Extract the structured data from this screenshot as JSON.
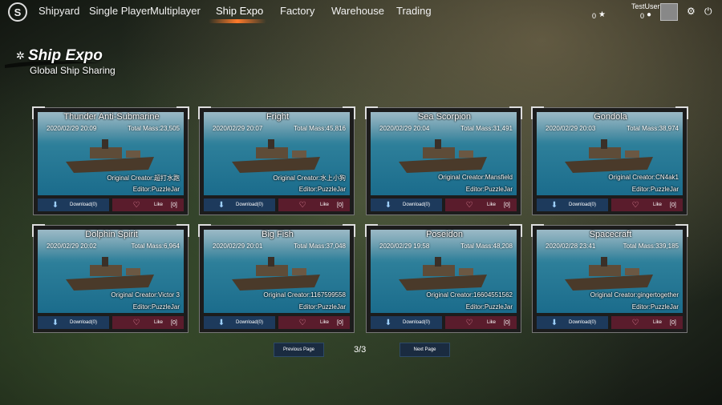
{
  "nav": {
    "logo_letter": "S",
    "items": [
      "Shipyard",
      "Single Player",
      "Multiplayer",
      "Ship Expo",
      "Factory",
      "Warehouse",
      "Trading"
    ],
    "active": "Ship Expo"
  },
  "user": {
    "name": "TestUser",
    "stars": "0",
    "coins": "0"
  },
  "icons": {
    "logo": "ship-wheel-logo",
    "star": "star-icon",
    "coin": "coin-icon",
    "settings": "gear-icon",
    "power": "power-icon"
  },
  "header": {
    "title": "Ship Expo",
    "subtitle": "Global Ship Sharing"
  },
  "cards": [
    {
      "name": "Thunder Anti-Submarine",
      "date": "2020/02/29 20:09",
      "mass": "Total Mass:23,505",
      "creator": "Original Creator:超打水跑",
      "editor": "Editor:PuzzleJar",
      "download": "Download(0)",
      "like": "Like",
      "likes": "[0]"
    },
    {
      "name": "Fright",
      "date": "2020/02/29 20:07",
      "mass": "Total Mass:45,816",
      "creator": "Original Creator:水上小狗",
      "editor": "Editor:PuzzleJar",
      "download": "Download(0)",
      "like": "Like",
      "likes": "[0]"
    },
    {
      "name": "Sea Scorpion",
      "date": "2020/02/29 20:04",
      "mass": "Total Mass:31,491",
      "creator": "Original Creator:Mansfield",
      "editor": "Editor:PuzzleJar",
      "download": "Download(0)",
      "like": "Like",
      "likes": "[0]"
    },
    {
      "name": "Gondola",
      "date": "2020/02/29 20:03",
      "mass": "Total Mass:38,974",
      "creator": "Original Creator:CN4ak1",
      "editor": "Editor:PuzzleJar",
      "download": "Download(0)",
      "like": "Like",
      "likes": "[0]"
    },
    {
      "name": "Dolphin Spirit",
      "date": "2020/02/29 20:02",
      "mass": "Total Mass:6,964",
      "creator": "Original Creator:Victor 3",
      "editor": "Editor:PuzzleJar",
      "download": "Download(0)",
      "like": "Like",
      "likes": "[0]"
    },
    {
      "name": "Big Fish",
      "date": "2020/02/29 20:01",
      "mass": "Total Mass:37,048",
      "creator": "Original Creator:1167599558",
      "editor": "Editor:PuzzleJar",
      "download": "Download(0)",
      "like": "Like",
      "likes": "[0]"
    },
    {
      "name": "Poseidon",
      "date": "2020/02/29 19:58",
      "mass": "Total Mass:48,208",
      "creator": "Original Creator:16604551562",
      "editor": "Editor:PuzzleJar",
      "download": "Download(0)",
      "like": "Like",
      "likes": "[0]"
    },
    {
      "name": "Spacecraft",
      "date": "2020/02/28 23:41",
      "mass": "Total Mass:339,185",
      "creator": "Original Creator:gingertogether",
      "editor": "Editor:PuzzleJar",
      "download": "Download(0)",
      "like": "Like",
      "likes": "[0]"
    }
  ],
  "pagination": {
    "previous": "Previous Page",
    "indicator": "3/3",
    "next": "Next Page"
  }
}
